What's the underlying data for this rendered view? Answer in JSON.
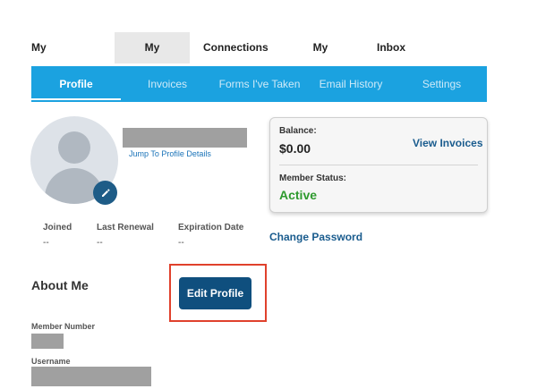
{
  "top_nav": {
    "tabs": [
      {
        "label": "My Community"
      },
      {
        "label": "My Profile"
      },
      {
        "label": "Connections"
      },
      {
        "label": "My Features"
      },
      {
        "label": "Inbox"
      }
    ]
  },
  "sub_nav": {
    "tabs": [
      {
        "label": "Profile"
      },
      {
        "label": "Invoices"
      },
      {
        "label": "Forms I've Taken"
      },
      {
        "label": "Email History"
      },
      {
        "label": "Settings"
      }
    ]
  },
  "profile": {
    "jump_link": "Jump To Profile Details",
    "meta": [
      {
        "label": "Joined",
        "value": "--"
      },
      {
        "label": "Last Renewal",
        "value": "--"
      },
      {
        "label": "Expiration Date",
        "value": "--"
      }
    ]
  },
  "balance_card": {
    "balance_label": "Balance:",
    "balance_value": "$0.00",
    "view_invoices": "View Invoices",
    "status_label": "Member Status:",
    "status_value": "Active",
    "status_color": "#2e9a2e"
  },
  "change_password": "Change Password",
  "about": {
    "title": "About Me",
    "edit_button": "Edit Profile",
    "member_number_label": "Member Number",
    "username_label": "Username"
  },
  "colors": {
    "sub_nav_bg": "#1ba2e0",
    "primary_button": "#0f4f7e",
    "highlight_border": "#e0412c"
  },
  "icons": {
    "avatar_placeholder": "user-silhouette-icon",
    "avatar_edit": "pencil-icon"
  }
}
